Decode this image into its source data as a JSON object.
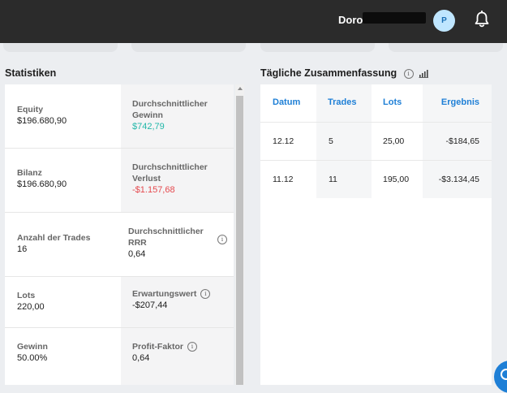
{
  "header": {
    "user_name": "Doro",
    "avatar_initial": "P"
  },
  "statistics": {
    "title": "Statistiken",
    "rows": [
      {
        "left_label": "Equity",
        "left_value": "$196.680,90",
        "right_label": "Durchschnittlicher Gewinn",
        "right_value": "$742,79"
      },
      {
        "left_label": "Bilanz",
        "left_value": "$196.680,90",
        "right_label": "Durchschnittlicher Verlust",
        "right_value": "-$1.157,68"
      },
      {
        "left_label": "Anzahl der Trades",
        "left_value": "16",
        "right_label": "Durchschnittlicher RRR",
        "right_value": "0,64"
      },
      {
        "left_label": "Lots",
        "left_value": "220,00",
        "right_label": "Erwartungswert",
        "right_value": "-$207,44"
      },
      {
        "left_label": "Gewinn",
        "left_value": "50.00%",
        "right_label": "Profit-Faktor",
        "right_value": "0,64"
      }
    ]
  },
  "daily_summary": {
    "title": "Tägliche Zusammenfassung",
    "columns": [
      "Datum",
      "Trades",
      "Lots",
      "Ergebnis"
    ],
    "rows": [
      {
        "date": "12.12",
        "trades": "5",
        "lots": "25,00",
        "result": "-$184,65"
      },
      {
        "date": "11.12",
        "trades": "11",
        "lots": "195,00",
        "result": "-$3.134,45"
      }
    ]
  },
  "colors": {
    "header_bg": "#2b2b2b",
    "accent_blue": "#1e7fd6",
    "positive": "#22b7a9",
    "negative": "#e5484d"
  },
  "icons": [
    "bell-icon",
    "info-icon",
    "bar-chart-icon",
    "chat-icon"
  ]
}
